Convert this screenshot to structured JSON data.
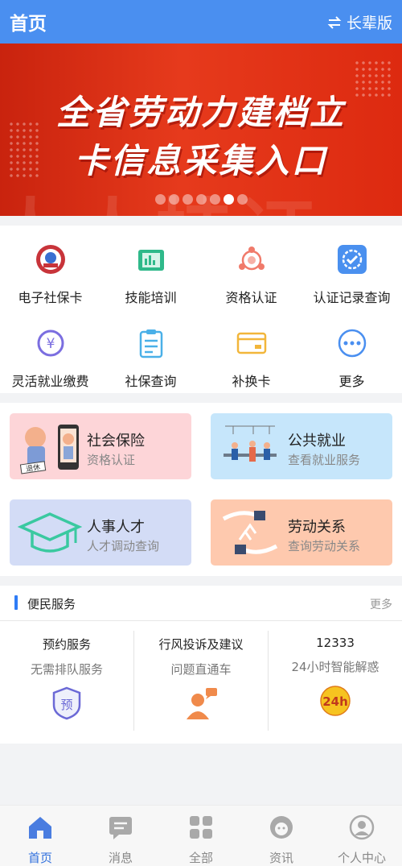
{
  "header": {
    "title": "首页",
    "elder_mode": "长辈版"
  },
  "banner": {
    "line1": "全省劳动力建档立",
    "line2": "卡信息采集入口",
    "watermark": "人人持证",
    "page_count": 7,
    "active_index": 5
  },
  "quick_items": [
    {
      "label": "电子社保卡",
      "icon": "social-security-card-icon"
    },
    {
      "label": "技能培训",
      "icon": "skill-training-icon"
    },
    {
      "label": "资格认证",
      "icon": "qualification-icon"
    },
    {
      "label": "认证记录查询",
      "icon": "record-check-icon"
    },
    {
      "label": "灵活就业缴费",
      "icon": "yuan-payment-icon"
    },
    {
      "label": "社保查询",
      "icon": "clipboard-icon"
    },
    {
      "label": "补换卡",
      "icon": "card-icon"
    },
    {
      "label": "更多",
      "icon": "more-icon"
    }
  ],
  "cards": [
    {
      "title": "社会保险",
      "subtitle": "资格认证",
      "color": "#fdd5d8",
      "art_tag": "退休"
    },
    {
      "title": "公共就业",
      "subtitle": "查看就业服务",
      "color": "#c6e6fb"
    },
    {
      "title": "人事人才",
      "subtitle": "人才调动查询",
      "color": "#d3dcf6"
    },
    {
      "title": "劳动关系",
      "subtitle": "查询劳动关系",
      "color": "#fec9ae"
    }
  ],
  "services": {
    "title": "便民服务",
    "more": "更多",
    "items": [
      {
        "title": "预约服务",
        "subtitle": "无需排队服务",
        "icon": "reservation-icon",
        "icon_text": "预"
      },
      {
        "title": "行风投诉及建议",
        "subtitle": "问题直通车",
        "icon": "person-chat-icon"
      },
      {
        "title": "12333",
        "subtitle": "24小时智能解惑",
        "icon": "24h-icon",
        "icon_text": "24h"
      }
    ]
  },
  "tabs": [
    {
      "label": "首页",
      "icon": "home-icon",
      "active": true
    },
    {
      "label": "消息",
      "icon": "message-icon",
      "active": false
    },
    {
      "label": "全部",
      "icon": "grid-icon",
      "active": false
    },
    {
      "label": "资讯",
      "icon": "news-icon",
      "active": false
    },
    {
      "label": "个人中心",
      "icon": "profile-icon",
      "active": false
    }
  ],
  "colors": {
    "header": "#4a8ff0",
    "banner": "#e63a1c",
    "accent": "#2f6fdd"
  }
}
